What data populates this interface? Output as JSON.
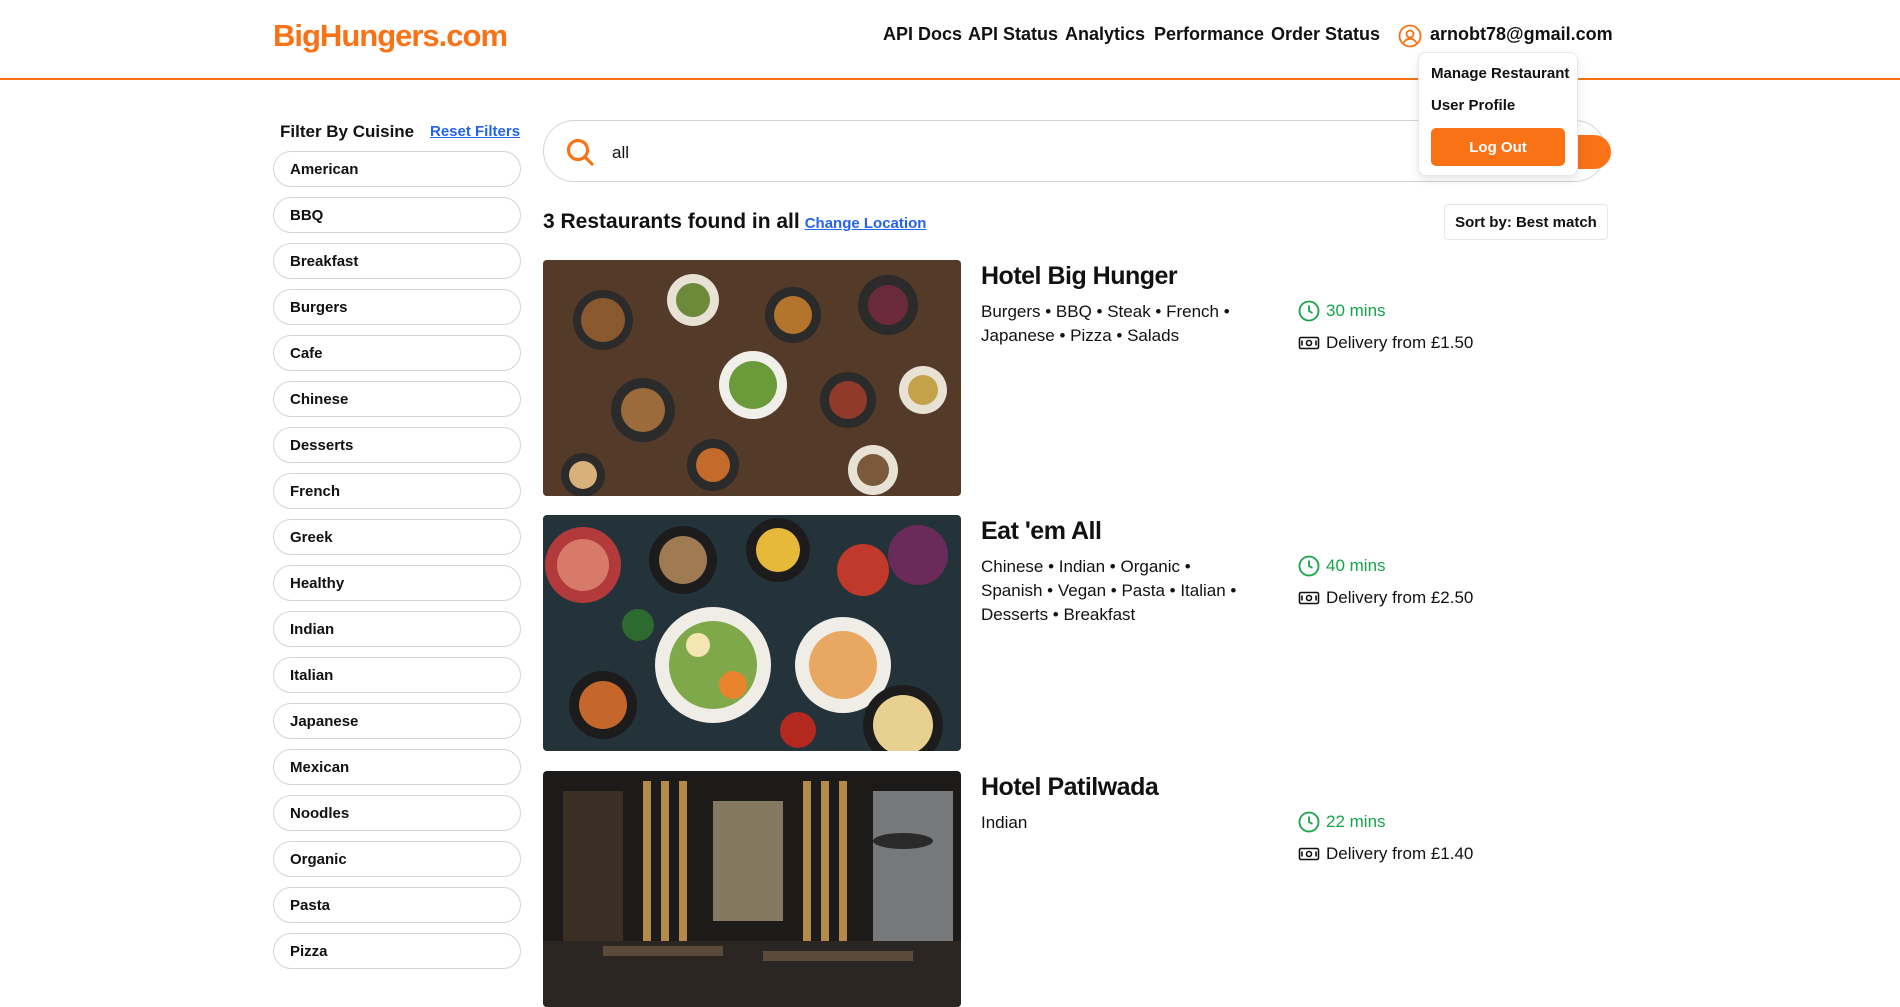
{
  "header": {
    "logo": "BigHungers.com",
    "nav": [
      "API Docs",
      "API Status",
      "Analytics",
      "Performance",
      "Order Status"
    ],
    "user_email": "arnobt78@gmail.com",
    "menu": {
      "manage": "Manage Restaurant",
      "profile": "User Profile",
      "logout": "Log Out"
    }
  },
  "filters": {
    "title": "Filter By Cuisine",
    "reset": "Reset Filters",
    "cuisines": [
      "American",
      "BBQ",
      "Breakfast",
      "Burgers",
      "Cafe",
      "Chinese",
      "Desserts",
      "French",
      "Greek",
      "Healthy",
      "Indian",
      "Italian",
      "Japanese",
      "Mexican",
      "Noodles",
      "Organic",
      "Pasta",
      "Pizza"
    ]
  },
  "search": {
    "value": "all",
    "placeholder": ""
  },
  "results": {
    "count_text": "3 Restaurants found in all",
    "change_location": "Change Location",
    "sort_label": "Sort by: Best match"
  },
  "restaurants": [
    {
      "name": "Hotel Big Hunger",
      "cuisines_line1": "Burgers • BBQ • Steak • French •",
      "cuisines_line2": "Japanese • Pizza • Salads",
      "cuisines_line3": "",
      "time": "30 mins",
      "delivery": "Delivery from £1.50"
    },
    {
      "name": "Eat 'em All",
      "cuisines_line1": "Chinese • Indian • Organic •",
      "cuisines_line2": "Spanish • Vegan • Pasta • Italian •",
      "cuisines_line3": "Desserts • Breakfast",
      "time": "40 mins",
      "delivery": "Delivery from £2.50"
    },
    {
      "name": "Hotel Patilwada",
      "cuisines_line1": "Indian",
      "cuisines_line2": "",
      "cuisines_line3": "",
      "time": "22 mins",
      "delivery": "Delivery from £1.40"
    }
  ],
  "colors": {
    "accent": "#f97316",
    "link": "#2563eb",
    "time": "#16a34a"
  }
}
